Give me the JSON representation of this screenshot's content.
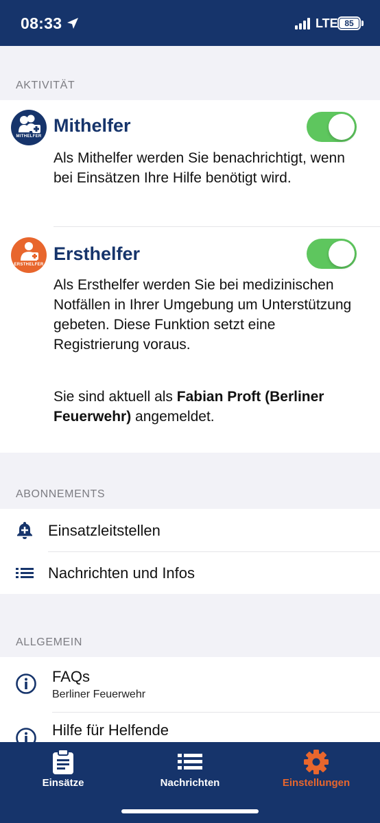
{
  "status_bar": {
    "time": "08:33",
    "network": "LTE",
    "battery": "85"
  },
  "sections": {
    "activity": "AKTIVITÄT",
    "subscriptions": "ABONNEMENTS",
    "general": "ALLGEMEIN"
  },
  "activity": {
    "mithelfer": {
      "badge_text": "MITHELFER",
      "title": "Mithelfer",
      "enabled": true,
      "description": "Als Mithelfer werden Sie benachrichtigt, wenn bei Einsätzen Ihre Hilfe benötigt wird."
    },
    "ersthelfer": {
      "badge_text": "ERSTHELFER",
      "title": "Ersthelfer",
      "enabled": true,
      "description": "Als Ersthelfer werden Sie bei medizinischen Notfällen in Ihrer Umgebung um Unterstützung gebeten. Diese Funktion setzt eine Registrierung voraus.",
      "login_prefix": "Sie sind aktuell als ",
      "login_name": "Fabian  Proft (Berliner Feuerwehr)",
      "login_suffix": " angemeldet."
    }
  },
  "subscriptions": [
    {
      "label": "Einsatzleitstellen",
      "icon": "bell-plus-icon"
    },
    {
      "label": "Nachrichten und Infos",
      "icon": "list-icon"
    }
  ],
  "general": [
    {
      "title": "FAQs",
      "subtitle": "Berliner Feuerwehr",
      "icon": "info-icon"
    },
    {
      "title": "Hilfe für Helfende",
      "icon": "info-icon"
    }
  ],
  "tabs": [
    {
      "label": "Einsätze",
      "icon": "clipboard-icon",
      "active": false
    },
    {
      "label": "Nachrichten",
      "icon": "list-icon",
      "active": false
    },
    {
      "label": "Einstellungen",
      "icon": "gear-icon",
      "active": true
    }
  ],
  "colors": {
    "primary": "#16346b",
    "accent": "#e8662d",
    "toggle_on": "#5ec65e",
    "background": "#f2f2f7"
  }
}
